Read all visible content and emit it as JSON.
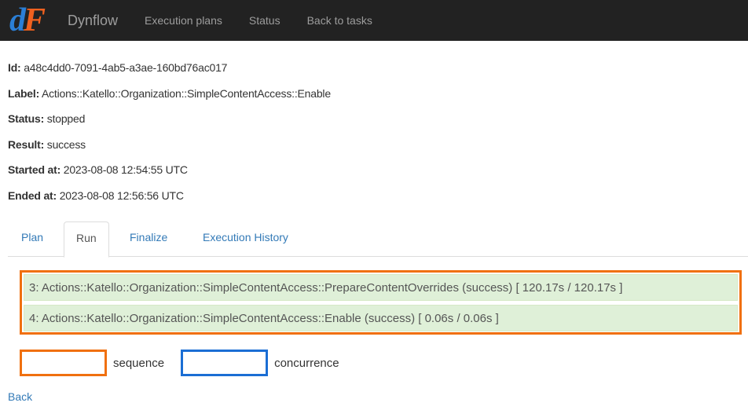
{
  "navbar": {
    "logo_d": "d",
    "logo_f": "F",
    "brand": "Dynflow",
    "items": [
      "Execution plans",
      "Status",
      "Back to tasks"
    ]
  },
  "info": [
    {
      "key": "Id:",
      "value": "a48c4dd0-7091-4ab5-a3ae-160bd76ac017"
    },
    {
      "key": "Label:",
      "value": "Actions::Katello::Organization::SimpleContentAccess::Enable"
    },
    {
      "key": "Status:",
      "value": "stopped"
    },
    {
      "key": "Result:",
      "value": "success"
    },
    {
      "key": "Started at:",
      "value": "2023-08-08 12:54:55 UTC"
    },
    {
      "key": "Ended at:",
      "value": "2023-08-08 12:56:56 UTC"
    }
  ],
  "tabs": [
    {
      "label": "Plan",
      "active": false
    },
    {
      "label": "Run",
      "active": true
    },
    {
      "label": "Finalize",
      "active": false
    },
    {
      "label": "Execution History",
      "active": false
    }
  ],
  "steps": [
    "3: Actions::Katello::Organization::SimpleContentAccess::PrepareContentOverrides (success) [ 120.17s / 120.17s ]",
    "4: Actions::Katello::Organization::SimpleContentAccess::Enable (success) [ 0.06s / 0.06s ]"
  ],
  "legend": {
    "sequence": "sequence",
    "concurrence": "concurrence"
  },
  "back_link": "Back",
  "colors": {
    "sequence": "#f0700f",
    "concurrence": "#1b6ed4",
    "success_bg": "#dff0d8",
    "link": "#337ab7",
    "navbar_bg": "#222222"
  }
}
